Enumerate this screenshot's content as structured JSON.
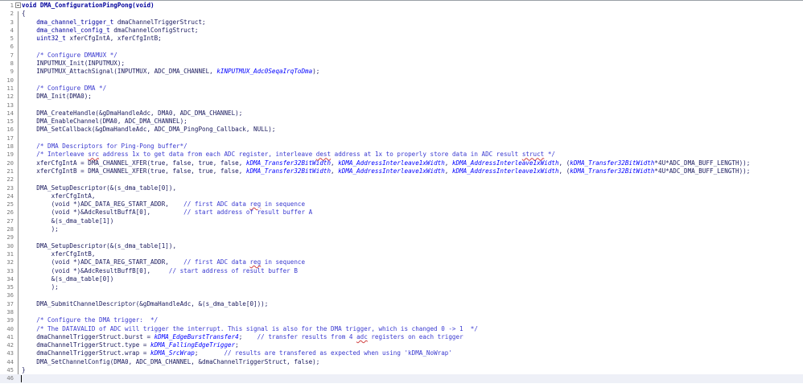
{
  "editor": {
    "current_line": 46,
    "lines": [
      [
        [
          "void",
          "kw"
        ],
        [
          " "
        ],
        [
          "DMA_ConfigurationPingPong",
          "kw"
        ],
        [
          "(void)",
          "kw"
        ]
      ],
      [
        [
          "{"
        ]
      ],
      [
        [
          "    "
        ],
        [
          "dma_channel_trigger_t",
          "ty"
        ],
        [
          " dmaChannelTriggerStruct;"
        ]
      ],
      [
        [
          "    "
        ],
        [
          "dma_channel_config_t",
          "ty"
        ],
        [
          " dmaChannelConfigStruct;"
        ]
      ],
      [
        [
          "    "
        ],
        [
          "uint32_t",
          "ty"
        ],
        [
          " xferCfgIntA, xferCfgIntB;"
        ]
      ],
      [
        [
          ""
        ]
      ],
      [
        [
          "    "
        ],
        [
          "/* Configure DMAMUX */",
          "cm"
        ]
      ],
      [
        [
          "    INPUTMUX_Init(INPUTMUX);"
        ]
      ],
      [
        [
          "    INPUTMUX_AttachSignal(INPUTMUX, ADC_DMA_CHANNEL, "
        ],
        [
          "kINPUTMUX_Adc0SeqaIrqToDma",
          "it"
        ],
        [
          ");"
        ]
      ],
      [
        [
          ""
        ]
      ],
      [
        [
          "    "
        ],
        [
          "/* Configure DMA */",
          "cm"
        ]
      ],
      [
        [
          "    DMA_Init(DMA0);"
        ]
      ],
      [
        [
          ""
        ]
      ],
      [
        [
          "    DMA_CreateHandle(&gDmaHandleAdc, DMA0, ADC_DMA_CHANNEL);"
        ]
      ],
      [
        [
          "    DMA_EnableChannel(DMA0, ADC_DMA_CHANNEL);"
        ]
      ],
      [
        [
          "    DMA_SetCallback(&gDmaHandleAdc, ADC_DMA_PingPong_Callback, NULL);"
        ]
      ],
      [
        [
          ""
        ]
      ],
      [
        [
          "    "
        ],
        [
          "/* DMA Descriptors for Ping-Pong buffer*/",
          "cm"
        ]
      ],
      [
        [
          "    "
        ],
        [
          "/* Interleave ",
          "cm"
        ],
        [
          "src",
          "cm sq"
        ],
        [
          " address 1x to get data from each ADC register, interleave ",
          "cm"
        ],
        [
          "dest",
          "cm sq"
        ],
        [
          " address at 1x to properly store data in ADC result ",
          "cm"
        ],
        [
          "struct",
          "cm sq"
        ],
        [
          " */",
          "cm"
        ]
      ],
      [
        [
          "    xferCfgIntA = DMA_CHANNEL_XFER(true, false, true, false, "
        ],
        [
          "kDMA_Transfer32BitWidth",
          "it"
        ],
        [
          ", "
        ],
        [
          "kDMA_AddressInterleave1xWidth",
          "it"
        ],
        [
          ", "
        ],
        [
          "kDMA_AddressInterleave1xWidth",
          "it"
        ],
        [
          ", ("
        ],
        [
          "kDMA_Transfer32BitWidth",
          "it"
        ],
        [
          "*4U*ADC_DMA_BUFF_LENGTH));"
        ]
      ],
      [
        [
          "    xferCfgIntB = DMA_CHANNEL_XFER(true, false, true, false, "
        ],
        [
          "kDMA_Transfer32BitWidth",
          "it"
        ],
        [
          ", "
        ],
        [
          "kDMA_AddressInterleave1xWidth",
          "it"
        ],
        [
          ", "
        ],
        [
          "kDMA_AddressInterleave1xWidth",
          "it"
        ],
        [
          ", ("
        ],
        [
          "kDMA_Transfer32BitWidth",
          "it"
        ],
        [
          "*4U*ADC_DMA_BUFF_LENGTH));"
        ]
      ],
      [
        [
          ""
        ]
      ],
      [
        [
          "    DMA_SetupDescriptor(&(s_dma_table[0]),"
        ]
      ],
      [
        [
          "        xferCfgIntA,"
        ]
      ],
      [
        [
          "        (void *)ADC_DATA_REG_START_ADDR,    "
        ],
        [
          "// first ADC data ",
          "cm"
        ],
        [
          "reg",
          "cm sq"
        ],
        [
          " in sequence",
          "cm"
        ]
      ],
      [
        [
          "        (void *)&AdcResultBuffA[0],         "
        ],
        [
          "// start address of result buffer A",
          "cm"
        ]
      ],
      [
        [
          "        &(s_dma_table[1])"
        ]
      ],
      [
        [
          "        );"
        ]
      ],
      [
        [
          ""
        ]
      ],
      [
        [
          "    DMA_SetupDescriptor(&(s_dma_table[1]),"
        ]
      ],
      [
        [
          "        xferCfgIntB,"
        ]
      ],
      [
        [
          "        (void *)ADC_DATA_REG_START_ADDR,    "
        ],
        [
          "// first ADC data ",
          "cm"
        ],
        [
          "reg",
          "cm sq"
        ],
        [
          " in sequence",
          "cm"
        ]
      ],
      [
        [
          "        (void *)&AdcResultBuffB[0],     "
        ],
        [
          "// start address of result buffer B",
          "cm"
        ]
      ],
      [
        [
          "        &(s_dma_table[0])"
        ]
      ],
      [
        [
          "        );"
        ]
      ],
      [
        [
          ""
        ]
      ],
      [
        [
          "    DMA_SubmitChannelDescriptor(&gDmaHandleAdc, &(s_dma_table[0]));"
        ]
      ],
      [
        [
          ""
        ]
      ],
      [
        [
          "    "
        ],
        [
          "/* Configure the DMA trigger:  */",
          "cm"
        ]
      ],
      [
        [
          "    "
        ],
        [
          "/* The DATAVALID of ADC will trigger the interrupt. This signal is also for the DMA trigger, which is changed 0 -> 1  */",
          "cm"
        ]
      ],
      [
        [
          "    dmaChannelTriggerStruct.burst = "
        ],
        [
          "kDMA_EdgeBurstTransfer4",
          "it"
        ],
        [
          ";    "
        ],
        [
          "// transfer results from 4 ",
          "cm"
        ],
        [
          "adc",
          "cm sq"
        ],
        [
          " registers on each trigger",
          "cm"
        ]
      ],
      [
        [
          "    dmaChannelTriggerStruct.type = "
        ],
        [
          "kDMA_FallingEdgeTrigger",
          "it"
        ],
        [
          ";"
        ]
      ],
      [
        [
          "    dmaChannelTriggerStruct.wrap = "
        ],
        [
          "kDMA_SrcWrap",
          "it"
        ],
        [
          ";       "
        ],
        [
          "// results are transfered as expected when using 'kDMA_NoWrap'",
          "cm"
        ]
      ],
      [
        [
          "    DMA_SetChannelConfig(DMA0, ADC_DMA_CHANNEL, &dmaChannelTriggerStruct, false);"
        ]
      ],
      [
        [
          "}"
        ]
      ],
      [
        [
          ""
        ]
      ]
    ]
  }
}
